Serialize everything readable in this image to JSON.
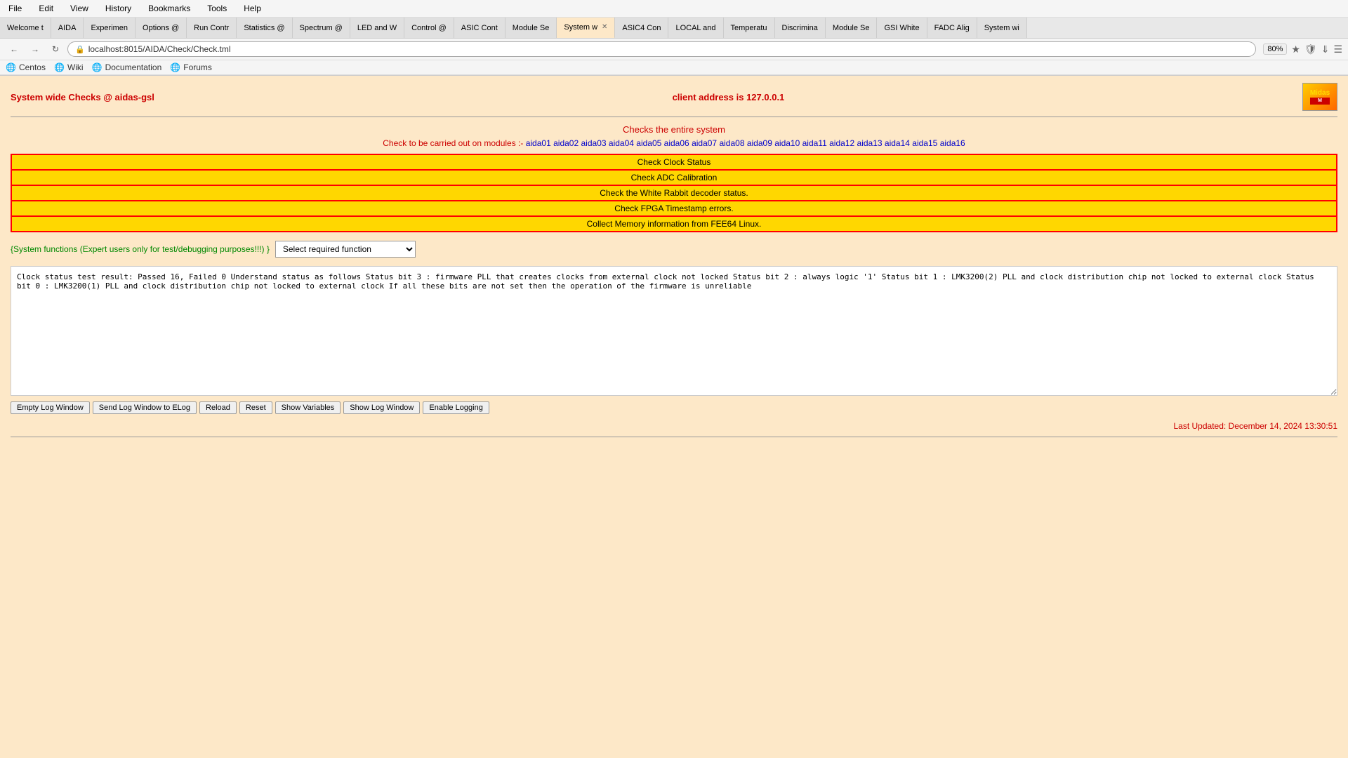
{
  "browser": {
    "menu": [
      "File",
      "Edit",
      "View",
      "History",
      "Bookmarks",
      "Tools",
      "Help"
    ],
    "tabs": [
      {
        "label": "Welcome t",
        "active": false
      },
      {
        "label": "AIDA",
        "active": false
      },
      {
        "label": "Experimen",
        "active": false
      },
      {
        "label": "Options @",
        "active": false
      },
      {
        "label": "Run Contr",
        "active": false
      },
      {
        "label": "Statistics @",
        "active": false
      },
      {
        "label": "Spectrum @",
        "active": false
      },
      {
        "label": "LED and W",
        "active": false
      },
      {
        "label": "Control @",
        "active": false
      },
      {
        "label": "ASIC Cont",
        "active": false
      },
      {
        "label": "Module Se",
        "active": false
      },
      {
        "label": "System w",
        "active": true,
        "closable": true
      },
      {
        "label": "ASIC4 Con",
        "active": false
      },
      {
        "label": "LOCAL and",
        "active": false
      },
      {
        "label": "Temperatu",
        "active": false
      },
      {
        "label": "Discrimina",
        "active": false
      },
      {
        "label": "Module Se",
        "active": false
      },
      {
        "label": "GSI White",
        "active": false
      },
      {
        "label": "FADC Alig",
        "active": false
      },
      {
        "label": "System wi",
        "active": false
      }
    ],
    "url": "localhost:8015/AIDA/Check/Check.tml",
    "zoom": "80%",
    "bookmarks": [
      {
        "label": "Centos",
        "icon": "globe"
      },
      {
        "label": "Wiki",
        "icon": "globe"
      },
      {
        "label": "Documentation",
        "icon": "globe"
      },
      {
        "label": "Forums",
        "icon": "globe"
      }
    ]
  },
  "page": {
    "title": "System wide Checks @ aidas-gsl",
    "client_address_label": "client address is 127.0.0.1",
    "checks_title": "Checks the entire system",
    "modules_label": "Check to be carried out on modules :-",
    "modules": [
      "aida01",
      "aida02",
      "aida03",
      "aida04",
      "aida05",
      "aida06",
      "aida07",
      "aida08",
      "aida09",
      "aida10",
      "aida11",
      "aida12",
      "aida13",
      "aida14",
      "aida15",
      "aida16"
    ],
    "check_buttons": [
      "Check Clock Status",
      "Check ADC Calibration",
      "Check the White Rabbit decoder status.",
      "Check FPGA Timestamp errors.",
      "Collect Memory information from FEE64 Linux."
    ],
    "system_functions_label": "{System functions (Expert users only for test/debugging purposes!!!) }",
    "select_placeholder": "Select required function",
    "log_content": "Clock status test result: Passed 16, Failed 0\n\nUnderstand status as follows\nStatus bit 3 : firmware PLL that creates clocks from external clock not locked\nStatus bit 2 : always logic '1'\nStatus bit 1 : LMK3200(2) PLL and clock distribution chip not locked to external clock\nStatus bit 0 : LMK3200(1) PLL and clock distribution chip not locked to external clock\nIf all these bits are not set then the operation of the firmware is unreliable",
    "bottom_buttons": [
      "Empty Log Window",
      "Send Log Window to ELog",
      "Reload",
      "Reset",
      "Show Variables",
      "Show Log Window",
      "Enable Logging"
    ],
    "last_updated": "Last Updated: December 14, 2024 13:30:51"
  }
}
